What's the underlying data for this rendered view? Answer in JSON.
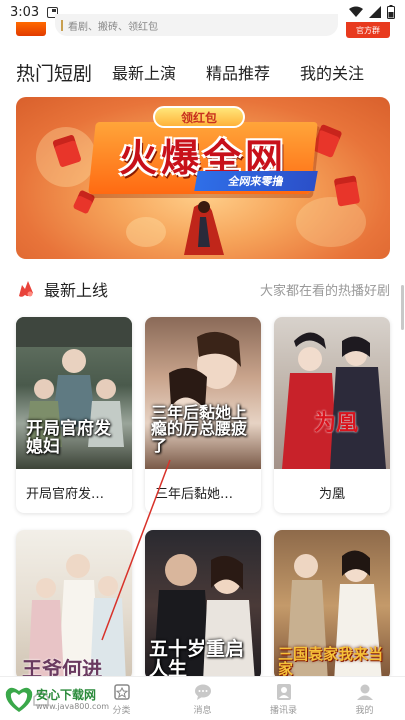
{
  "status": {
    "time": "3:03"
  },
  "header": {
    "search_hint": "看剧、搬砖、领红包",
    "badge": "官方群"
  },
  "tabs": [
    {
      "label": "热门短剧",
      "active": true
    },
    {
      "label": "最新上演",
      "active": false
    },
    {
      "label": "精品推荐",
      "active": false
    },
    {
      "label": "我的关注",
      "active": false
    }
  ],
  "banner": {
    "pill": "领红包",
    "title": "火爆全网",
    "subtitle": "全网来零撸"
  },
  "section": {
    "title": "最新上线",
    "subtitle": "大家都在看的热播好剧"
  },
  "dramas": [
    {
      "poster_text": "开局官府发媳妇",
      "label": "开局官府发…"
    },
    {
      "poster_text": "三年后黏她上瘾的厉总腰疲了",
      "label": "三年后黏她…"
    },
    {
      "poster_text": "为凰",
      "label": "为凰"
    },
    {
      "poster_text": "王爷何进",
      "label": ""
    },
    {
      "poster_text": "五十岁重启人生",
      "label": ""
    },
    {
      "poster_text": "三国袁家我来当家",
      "label": ""
    }
  ],
  "bottom_nav": [
    {
      "label": "",
      "icon": "home-icon"
    },
    {
      "label": "分类",
      "icon": "category-icon"
    },
    {
      "label": "消息",
      "icon": "message-icon"
    },
    {
      "label": "播讯录",
      "icon": "contacts-icon"
    },
    {
      "label": "我的",
      "icon": "profile-icon"
    }
  ],
  "watermark": {
    "name": "安心下载网",
    "url": "www.java800.com"
  },
  "colors": {
    "accent": "#e83a1e",
    "text": "#222222",
    "muted": "#999999"
  }
}
